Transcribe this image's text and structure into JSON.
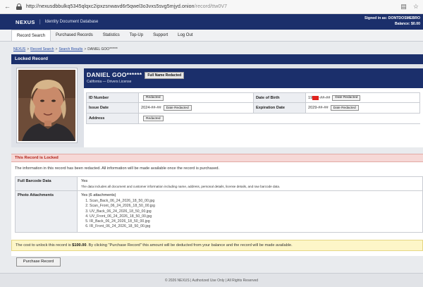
{
  "browser": {
    "url_host": "http://nexusdbbulkq5345qlqxc2ipxzsnwavd6r5qwel3o3vxs5svg5mjyd.onion",
    "url_path": "/record/ttw0V7"
  },
  "header": {
    "brand": "NEXUS",
    "separator": "|",
    "subtitle": "Identity Document Database",
    "signed_in": "Signed in as: DONTDOSMEBRO",
    "balance": "Balance: $0.00"
  },
  "nav": {
    "items": [
      {
        "label": "Record Search",
        "active": true
      },
      {
        "label": "Purchased Records",
        "active": false
      },
      {
        "label": "Statistics",
        "active": false
      },
      {
        "label": "Top-Up",
        "active": false
      },
      {
        "label": "Support",
        "active": false
      },
      {
        "label": "Log Out",
        "active": false
      }
    ]
  },
  "breadcrumb": {
    "items": [
      "NEXUS",
      "Record Search",
      "Search Results",
      "DANIEL GOO******"
    ],
    "separator": ">"
  },
  "panel": {
    "title": "Locked Record"
  },
  "record": {
    "name": "DANIEL GOO******",
    "name_badge": "Full Name Redacted",
    "subtitle": "California — Drivers License",
    "fields": {
      "id_number_label": "ID Number",
      "id_number_btn": "Redacted",
      "dob_label": "Date of Birth",
      "dob_prefix": "19",
      "dob_suffix": "-##-##",
      "dob_btn": "Date Redacted",
      "issue_label": "Issue Date",
      "issue_value": "2024-##-##",
      "issue_btn": "Date Redacted",
      "exp_label": "Expiration Date",
      "exp_value": "2029-##-##",
      "exp_btn": "Date Redacted",
      "address_label": "Address",
      "address_btn": "Redacted"
    }
  },
  "locked": {
    "title": "This Record is Locked",
    "message": "The information in this record has been redacted. All information will be made available once the record is purchased.",
    "barcode_label": "Full Barcode Data",
    "barcode_value": "Yes",
    "barcode_note": "The data includes all document and customer information including name, address, personal details, license details, and raw barcode data.",
    "photos_label": "Photo Attachments",
    "photos_value": "Yes (6 attachments)",
    "files": [
      "Scan_Back_06_24_2026_18_50_00.jpg",
      "Scan_Front_06_24_2026_18_50_00.jpg",
      "UV_Back_06_24_2026_18_50_00.jpg",
      "UV_Front_06_24_2026_18_50_00.jpg",
      "IR_Back_06_24_2026_18_50_00.jpg",
      "IR_Front_06_24_2026_18_50_00.jpg"
    ]
  },
  "cost": {
    "prefix": "The cost to unlock this record is ",
    "amount": "$100.00",
    "suffix": ". By clicking \"Purchase Record\" this amount will be deducted from your balance and the record will be made available."
  },
  "purchase_button": "Purchase Record",
  "footer": "© 2026 NEXUS  |  Authorized Use Only  |  All Rights Reserved",
  "colors": {
    "header_navy": "#1b2f6b",
    "locked_red": "#b01c12",
    "redaction_red": "#e0231e",
    "notice_yellow": "#fdf6c8"
  }
}
